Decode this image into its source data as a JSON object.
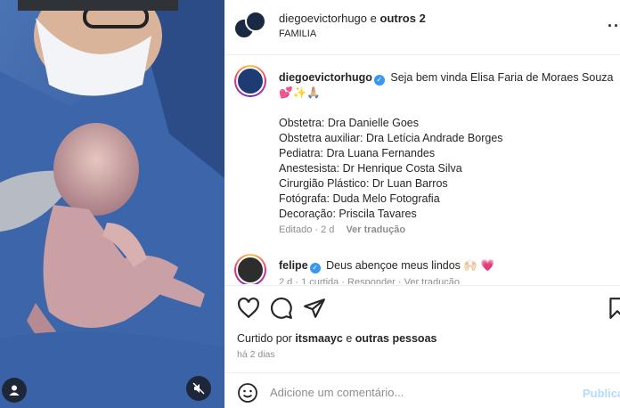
{
  "post_header": {
    "account": "diegoevictorhugo",
    "connector": "e",
    "collaborators": "outros 2",
    "subtitle": "FAMILIA",
    "more_icon": "more-horizontal-icon"
  },
  "caption": {
    "username": "diegoevictorhugo",
    "verified_icon": "verified-badge-icon",
    "text": "Seja bem vinda Elisa Faria de Moraes Souza",
    "emojis": "💕✨🙏🏼",
    "credits": [
      "Obstetra: Dra Danielle Goes",
      "Obstetra auxiliar: Dra Letícia Andrade Borges",
      "Pediatra: Dra Luana Fernandes",
      "Anestesista: Dr Henrique Costa Silva",
      "Cirurgião Plástico: Dr Luan Barros",
      "Fotógrafa: Duda Melo Fotografia",
      "Decoração: Priscila Tavares"
    ],
    "meta": "Editado · 2 d",
    "translate_link": "Ver tradução"
  },
  "comment": {
    "username": "felipe",
    "text": "Deus abençoe meus lindos",
    "emojis": "🙌🏻 💗",
    "meta": "2 d · 1 curtida · Responder · Ver tradução"
  },
  "actions": {
    "like_icon": "heart-icon",
    "comment_icon": "comment-icon",
    "share_icon": "send-icon",
    "save_icon": "bookmark-icon"
  },
  "likes": {
    "prefix": "Curtido por",
    "user": "itsmaayc",
    "connector": "e",
    "others": "outras pessoas"
  },
  "timestamp": "há 2 dias",
  "add_comment": {
    "placeholder": "Adicione um comentário...",
    "publish_label": "Publicar",
    "emoji_icon": "emoji-smile-icon"
  },
  "media": {
    "user_tag_icon": "user-tag-icon",
    "mute_icon": "muted-speaker-icon"
  },
  "colors": {
    "verified": "#3897f0",
    "publish_disabled": "#b3dbff",
    "muted_text": "#8e8e8e",
    "border": "#efefef"
  }
}
